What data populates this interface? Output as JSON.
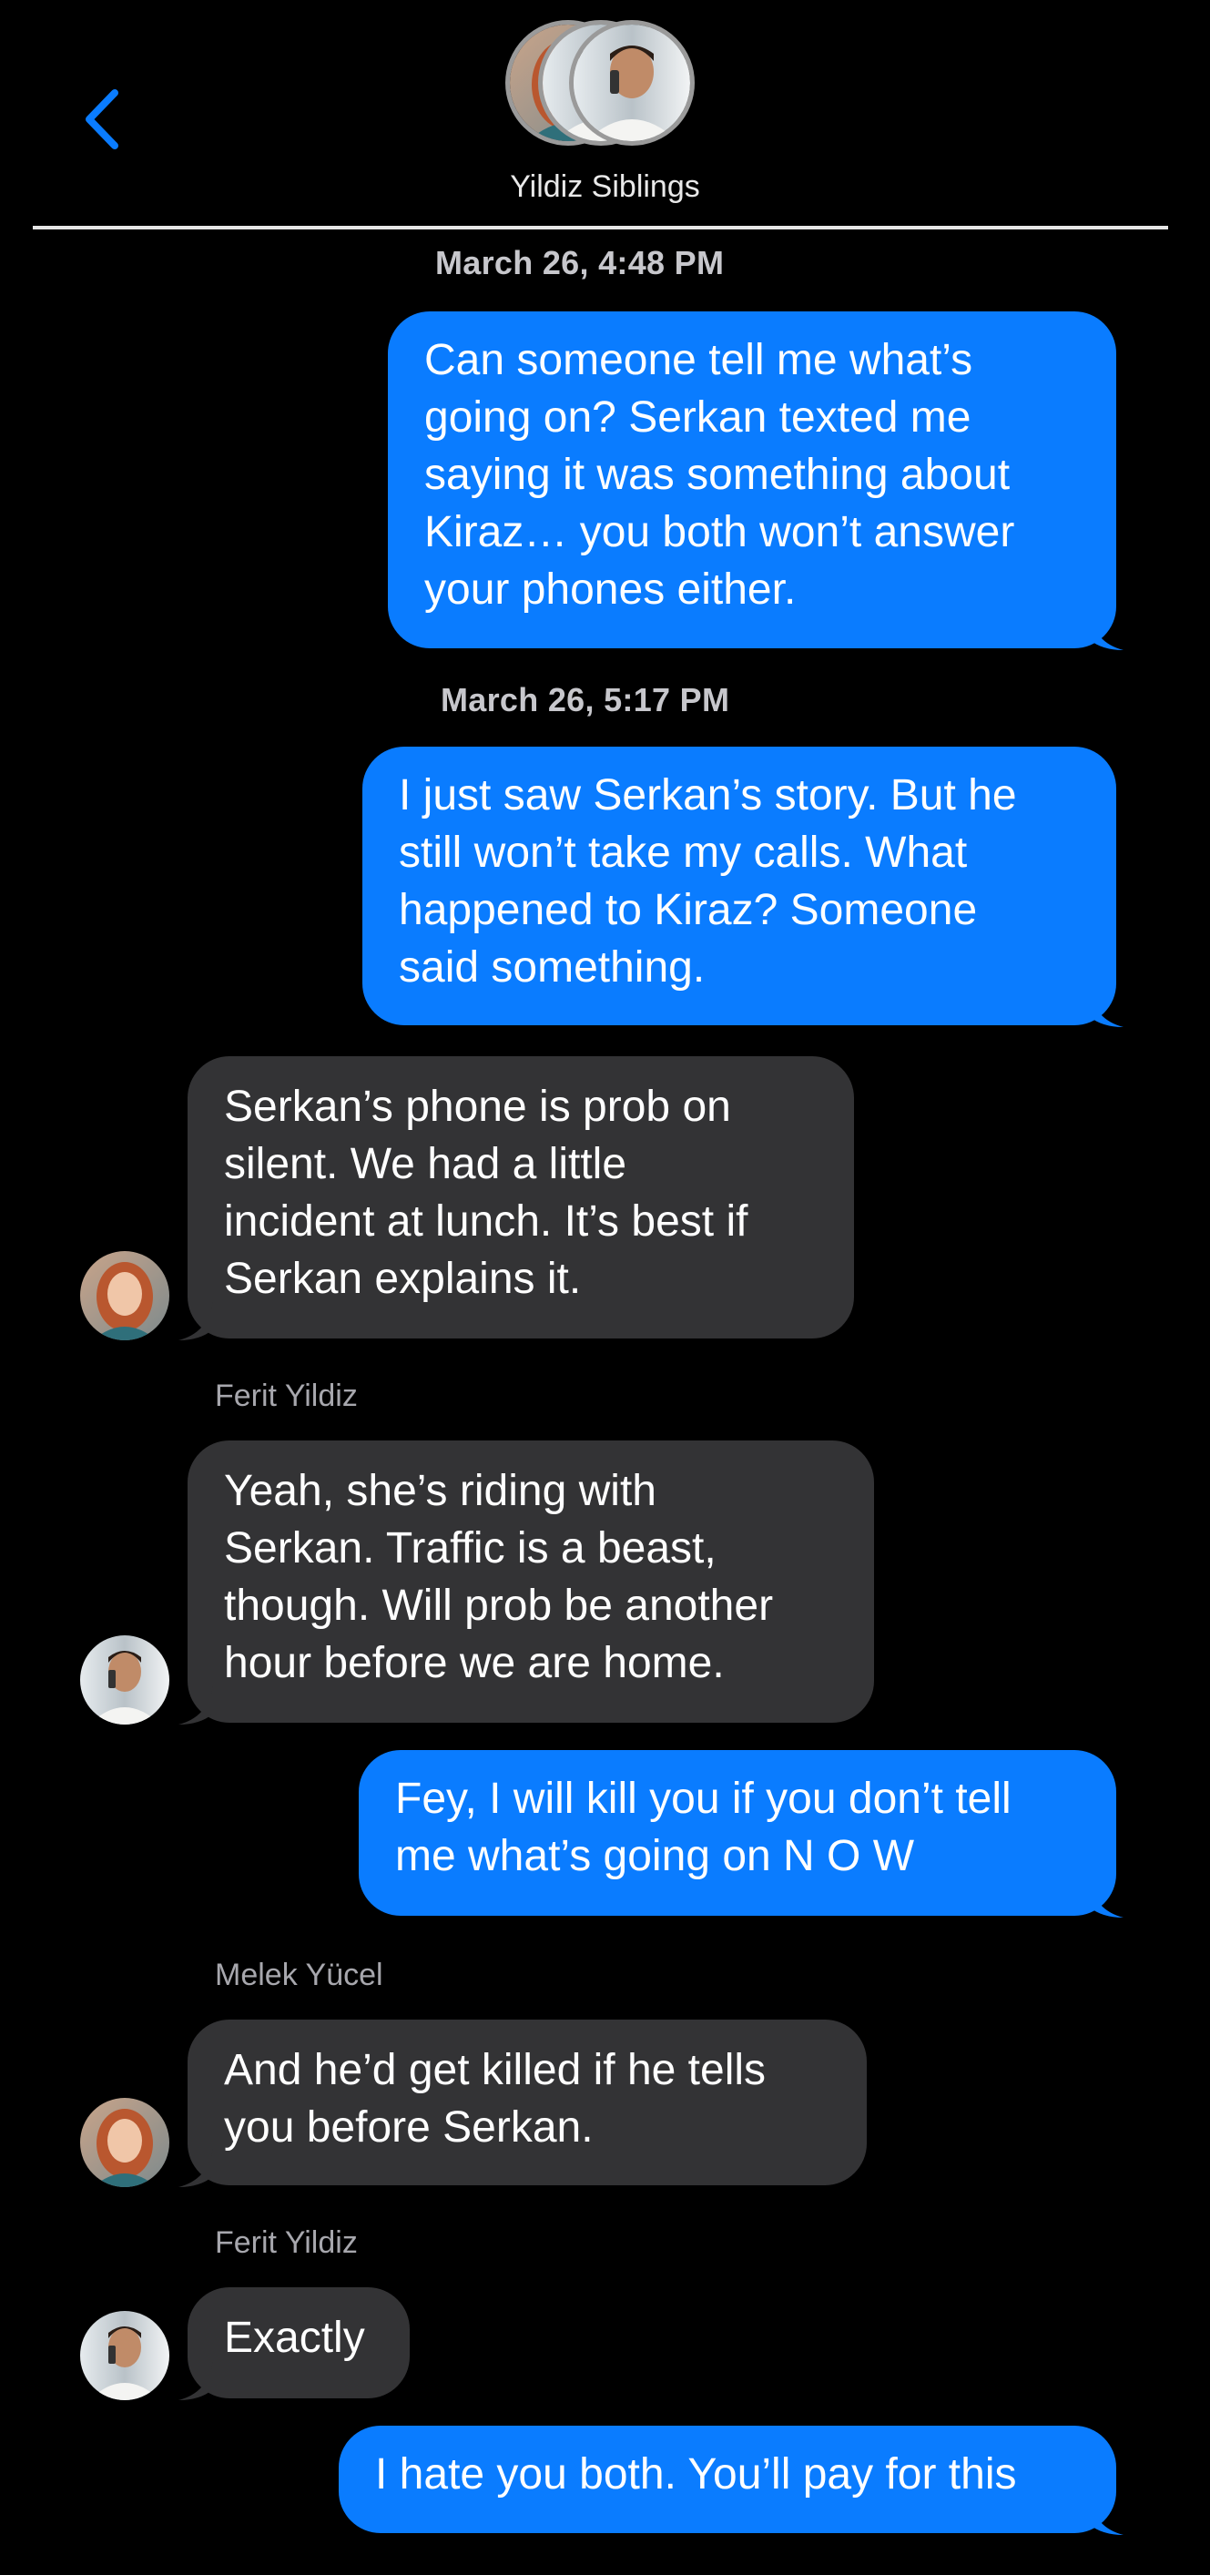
{
  "header": {
    "title": "Yildiz Siblings",
    "back_icon": "chevron-left-icon",
    "accent_color": "#0a7cff"
  },
  "colors": {
    "outgoing_bubble": "#0a7cff",
    "incoming_bubble": "#333335",
    "background": "#000000"
  },
  "thread": {
    "stamp_1": "March 26, 4:48 PM",
    "msg_1": [
      "Can someone tell me what’s",
      "going on? Serkan texted me",
      "saying it was something about",
      "Kiraz… you both won’t answer",
      "your phones either."
    ],
    "stamp_2": "March 26, 5:17 PM",
    "msg_2": [
      "I just saw Serkan’s story. But he",
      "still won’t take my calls. What",
      "happened to Kiraz? Someone",
      "said something."
    ],
    "msg_3": [
      "Serkan’s phone is prob on",
      "silent. We had a little",
      "incident at lunch. It’s best if",
      "Serkan explains it."
    ],
    "sender_4": "Ferit Yildiz",
    "msg_4": [
      "Yeah, she’s riding with",
      "Serkan. Traffic is a beast,",
      "though. Will prob be another",
      "hour before we are home."
    ],
    "msg_5": [
      "Fey, I will kill you if you don’t tell",
      "me what’s going on N O W"
    ],
    "sender_6": "Melek Yücel",
    "msg_6": [
      "And he’d get killed if he tells",
      "you before Serkan."
    ],
    "sender_7": "Ferit Yildiz",
    "msg_7": [
      "Exactly"
    ],
    "msg_8": [
      "I hate you both. You’ll pay for this"
    ]
  }
}
